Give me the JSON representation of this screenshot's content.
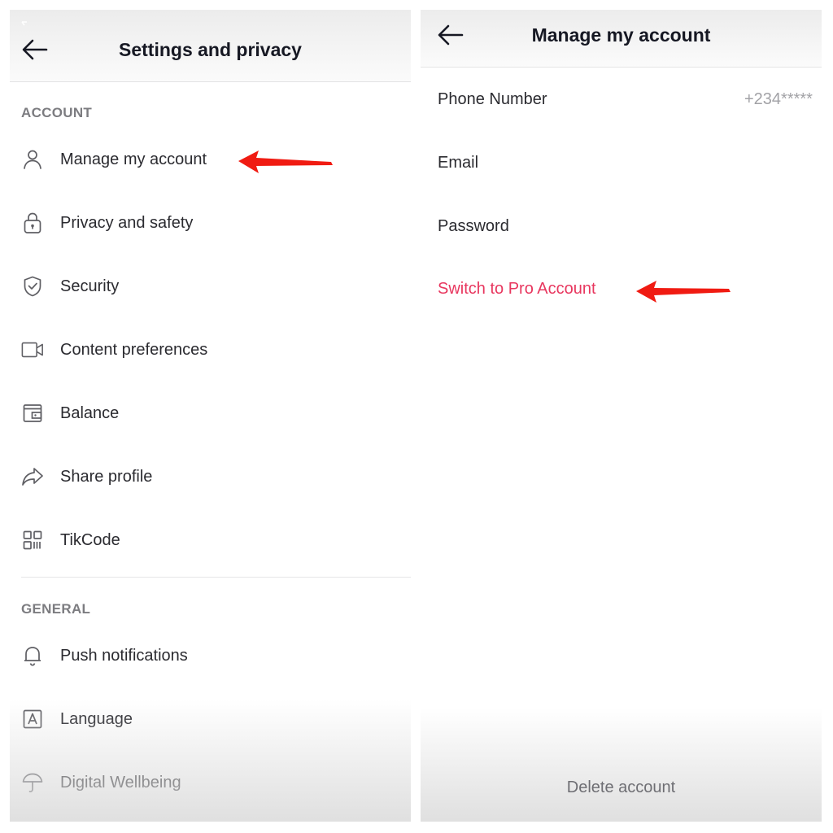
{
  "left_screen": {
    "title": "Settings and privacy",
    "sections": [
      {
        "label": "ACCOUNT",
        "items": [
          {
            "label": "Manage my account",
            "icon": "person-icon"
          },
          {
            "label": "Privacy and safety",
            "icon": "lock-icon"
          },
          {
            "label": "Security",
            "icon": "shield-icon"
          },
          {
            "label": "Content preferences",
            "icon": "video-icon"
          },
          {
            "label": "Balance",
            "icon": "wallet-icon"
          },
          {
            "label": "Share profile",
            "icon": "share-icon"
          },
          {
            "label": "TikCode",
            "icon": "qr-code-icon"
          }
        ]
      },
      {
        "label": "GENERAL",
        "items": [
          {
            "label": "Push notifications",
            "icon": "bell-icon"
          },
          {
            "label": "Language",
            "icon": "language-icon"
          },
          {
            "label": "Digital Wellbeing",
            "icon": "umbrella-icon"
          }
        ]
      }
    ]
  },
  "right_screen": {
    "title": "Manage my account",
    "rows": [
      {
        "label": "Phone Number",
        "value": "+234*****"
      },
      {
        "label": "Email"
      },
      {
        "label": "Password"
      },
      {
        "label": "Switch to Pro Account"
      }
    ],
    "delete_label": "Delete account"
  },
  "colors": {
    "accent_pink": "#e8375f",
    "annotation_arrow": "#f01b12",
    "text_primary": "#161823",
    "text_secondary": "#7c7c80"
  }
}
